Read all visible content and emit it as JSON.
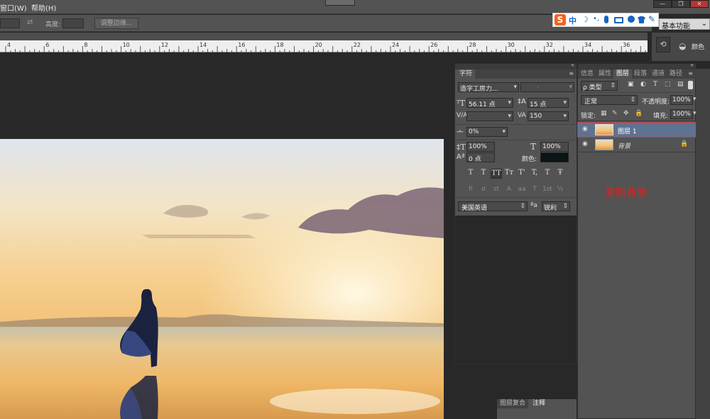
{
  "menubar": {
    "items": [
      "窗口(W)",
      "帮助(H)"
    ]
  },
  "window_buttons": [
    "—",
    "❐",
    "✕"
  ],
  "ime": {
    "logo": "S",
    "items": [
      "中",
      "☽",
      "•,",
      "🎤",
      "⌨",
      "👤",
      "👕",
      "🔧"
    ]
  },
  "options": {
    "height_label": "高度:",
    "refine_edge_button": "调整边缘..."
  },
  "workspace": {
    "label": "基本功能"
  },
  "ruler": {
    "ticks": [
      "4",
      "6",
      "8",
      "10",
      "12",
      "14",
      "16",
      "18",
      "20",
      "22",
      "24",
      "26",
      "28",
      "30",
      "32",
      "34",
      "36"
    ]
  },
  "right_strip": {
    "color_label": "颜色"
  },
  "character_panel": {
    "tab": "字符",
    "font_family": "造字工房力...",
    "font_style": "-",
    "font_size": "56.11 点",
    "leading": "15 点",
    "kerning": "",
    "tracking": "150",
    "tsume": "0%",
    "vertical_scale": "100%",
    "horizontal_scale": "100%",
    "baseline_shift": "0 点",
    "color_label": "颜色:",
    "text_color": "#0b1416",
    "style_buttons": [
      "T",
      "T",
      "TT",
      "Tт",
      "T'",
      "T,",
      "T",
      "Ŧ"
    ],
    "opentype_buttons": [
      "fi",
      "σ",
      "st",
      "A",
      "aa",
      "T",
      "1st",
      "½"
    ],
    "language": "美国英语",
    "aa_label": "ªa",
    "antialias": "锐利"
  },
  "layers_panel": {
    "tabs": [
      "信息",
      "属性",
      "图层",
      "段落",
      "通道",
      "路径"
    ],
    "filter_label": "ρ 类型",
    "blend_mode": "正常",
    "opacity_label": "不透明度:",
    "opacity": "100%",
    "lock_label": "锁定:",
    "fill_label": "填充:",
    "fill": "100%",
    "layers": [
      {
        "name": "图层 1",
        "selected": true
      },
      {
        "name": "背景",
        "selected": false
      }
    ],
    "annotation": "复制背景",
    "annotation_color": "#e02020"
  },
  "bottom_tabs": [
    "图层复合",
    "注释"
  ]
}
